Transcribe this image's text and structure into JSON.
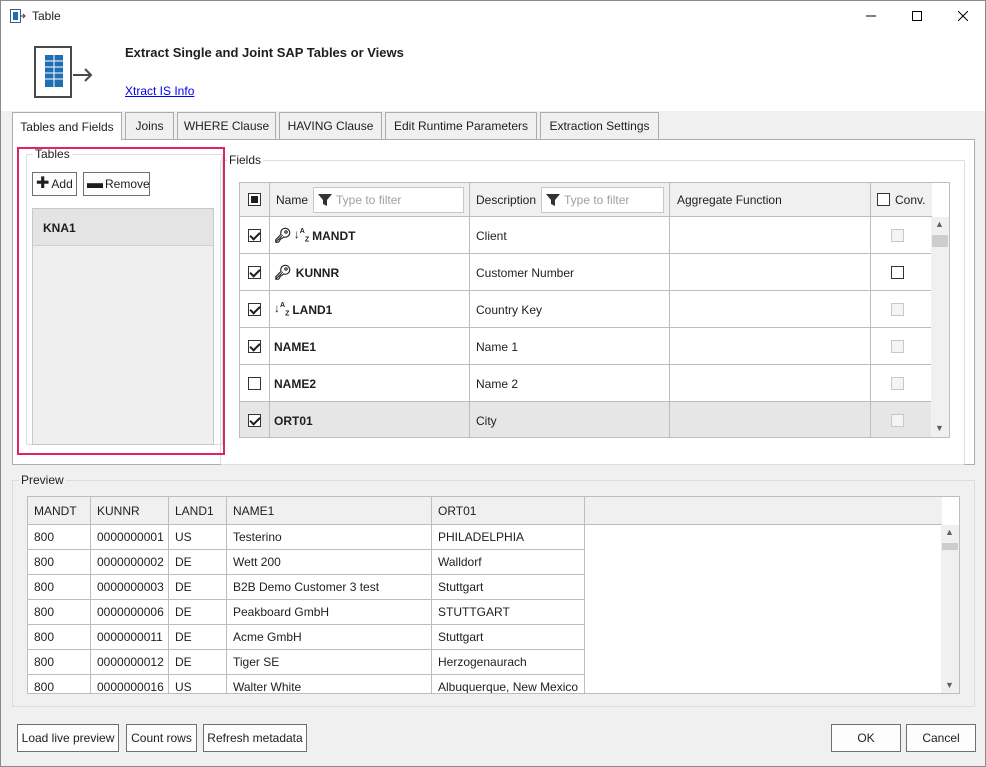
{
  "window": {
    "title": "Table"
  },
  "header": {
    "heading": "Extract Single and Joint SAP Tables or Views",
    "info_link": "Xtract IS Info"
  },
  "tabs": [
    {
      "label": "Tables and Fields",
      "active": true
    },
    {
      "label": "Joins"
    },
    {
      "label": "WHERE Clause"
    },
    {
      "label": "HAVING Clause"
    },
    {
      "label": "Edit Runtime Parameters"
    },
    {
      "label": "Extraction Settings"
    }
  ],
  "tables": {
    "legend": "Tables",
    "add_label": "Add",
    "remove_label": "Remove",
    "items": [
      "KNA1"
    ]
  },
  "fields": {
    "legend": "Fields",
    "columns": {
      "name": "Name",
      "name_filter": "Type to filter",
      "description": "Description",
      "description_filter": "Type to filter",
      "aggregate": "Aggregate Function",
      "conv": "Conv."
    },
    "rows": [
      {
        "name": "MANDT",
        "description": "Client",
        "checked": true,
        "key": true,
        "sort": true,
        "conv_enabled": false
      },
      {
        "name": "KUNNR",
        "description": "Customer Number",
        "checked": true,
        "key": true,
        "sort": false,
        "conv_enabled": true
      },
      {
        "name": "LAND1",
        "description": "Country Key",
        "checked": true,
        "key": false,
        "sort": true,
        "conv_enabled": false
      },
      {
        "name": "NAME1",
        "description": "Name 1",
        "checked": true,
        "key": false,
        "sort": false,
        "conv_enabled": false
      },
      {
        "name": "NAME2",
        "description": "Name 2",
        "checked": false,
        "key": false,
        "sort": false,
        "conv_enabled": false
      },
      {
        "name": "ORT01",
        "description": "City",
        "checked": true,
        "key": false,
        "sort": false,
        "conv_enabled": false,
        "selected": true
      }
    ]
  },
  "preview": {
    "legend": "Preview",
    "columns": [
      "MANDT",
      "KUNNR",
      "LAND1",
      "NAME1",
      "ORT01"
    ],
    "rows": [
      [
        "800",
        "0000000001",
        "US",
        "Testerino",
        "PHILADELPHIA"
      ],
      [
        "800",
        "0000000002",
        "DE",
        "Wett 200",
        "Walldorf"
      ],
      [
        "800",
        "0000000003",
        "DE",
        "B2B Demo Customer 3 test",
        "Stuttgart"
      ],
      [
        "800",
        "0000000006",
        "DE",
        "Peakboard GmbH",
        "STUTTGART"
      ],
      [
        "800",
        "0000000011",
        "DE",
        "Acme GmbH",
        "Stuttgart"
      ],
      [
        "800",
        "0000000012",
        "DE",
        "Tiger SE",
        "Herzogenaurach"
      ],
      [
        "800",
        "0000000016",
        "US",
        "Walter White",
        "Albuquerque, New Mexico"
      ]
    ]
  },
  "footer": {
    "load_live_preview": "Load live preview",
    "count_rows": "Count rows",
    "refresh_metadata": "Refresh metadata",
    "ok": "OK",
    "cancel": "Cancel"
  },
  "colors": {
    "highlight": "#e0245e",
    "link": "#0000ee",
    "logo_blue": "#1f6fb5"
  }
}
